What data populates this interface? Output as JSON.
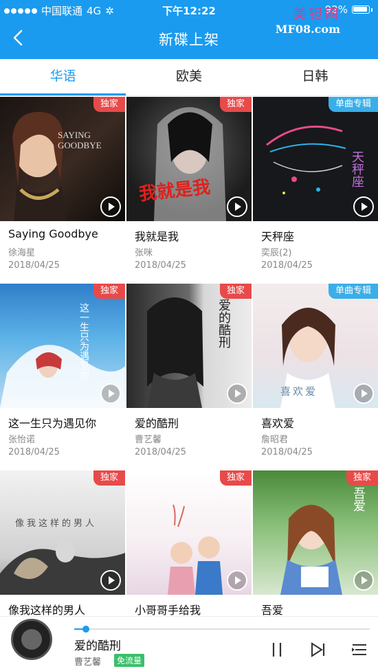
{
  "status_bar": {
    "carrier": "中国联通",
    "network": "4G",
    "time": "下午12:22",
    "battery": "92%"
  },
  "watermark": {
    "name": "美钽网",
    "site": "MF08.com"
  },
  "nav": {
    "title": "新碟上架"
  },
  "tabs": [
    {
      "label": "华语",
      "active": true
    },
    {
      "label": "欧美",
      "active": false
    },
    {
      "label": "日韩",
      "active": false
    }
  ],
  "albums": [
    {
      "title": "Saying Goodbye",
      "artist": "徐海星",
      "date": "2018/04/25",
      "badge": "独家",
      "badge_color": "#e84a4a",
      "cover_text": "SAYING GOODBYE"
    },
    {
      "title": "我就是我",
      "artist": "张咪",
      "date": "2018/04/25",
      "badge": "独家",
      "badge_color": "#e84a4a",
      "cover_text": "我就是我"
    },
    {
      "title": "天秤座",
      "artist": "奕辰(2)",
      "date": "2018/04/25",
      "badge": "单曲专辑",
      "badge_color": "#3aaee8",
      "cover_text": "天秤座"
    },
    {
      "title": "这一生只为遇见你",
      "artist": "张怡诺",
      "date": "2018/04/25",
      "badge": "独家",
      "badge_color": "#e84a4a",
      "cover_text": "这一生只为遇见你"
    },
    {
      "title": "爱的酷刑",
      "artist": "曹艺馨",
      "date": "2018/04/25",
      "badge": "独家",
      "badge_color": "#e84a4a",
      "cover_text": "爱的酷刑"
    },
    {
      "title": "喜欢爱",
      "artist": "詹昭君",
      "date": "2018/04/25",
      "badge": "单曲专辑",
      "badge_color": "#3aaee8",
      "cover_text": "喜欢爱"
    },
    {
      "title": "像我这样的男人",
      "artist": "",
      "date": "",
      "badge": "独家",
      "badge_color": "#e84a4a",
      "cover_text": "像我这样的男人"
    },
    {
      "title": "小哥哥手给我",
      "artist": "",
      "date": "",
      "badge": "独家",
      "badge_color": "#e84a4a",
      "cover_text": ""
    },
    {
      "title": "吾爱",
      "artist": "",
      "date": "",
      "badge": "独家",
      "badge_color": "#e84a4a",
      "cover_text": "吾爱"
    }
  ],
  "player": {
    "title": "爱的酷刑",
    "artist": "曹艺馨",
    "tag": "免流量",
    "progress": 0.04
  },
  "colors": {
    "accent": "#1a9bf0",
    "exclusive_badge": "#e84a4a",
    "single_badge": "#3aaee8",
    "free_traffic_tag": "#3bbf6a"
  }
}
